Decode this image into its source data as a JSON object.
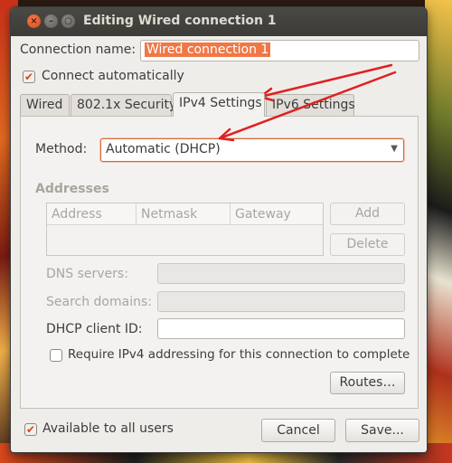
{
  "window": {
    "title": "Editing Wired connection 1"
  },
  "connection_name": {
    "label": "Connection name:",
    "value": "Wired connection 1"
  },
  "connect_automatically": {
    "label": "Connect automatically",
    "checked": true
  },
  "tabs": [
    {
      "label": "Wired",
      "active": false
    },
    {
      "label": "802.1x Security",
      "active": false
    },
    {
      "label": "IPv4 Settings",
      "active": true
    },
    {
      "label": "IPv6 Settings",
      "active": false
    }
  ],
  "ipv4": {
    "method_label": "Method:",
    "method_value": "Automatic (DHCP)",
    "addresses_heading": "Addresses",
    "columns": [
      "Address",
      "Netmask",
      "Gateway"
    ],
    "add_label": "Add",
    "delete_label": "Delete",
    "dns_label": "DNS servers:",
    "search_domains_label": "Search domains:",
    "dhcp_client_id_label": "DHCP client ID:",
    "require_label": "Require IPv4 addressing for this connection to complete",
    "require_checked": false,
    "routes_label": "Routes…"
  },
  "footer": {
    "available_label": "Available to all users",
    "available_checked": true,
    "cancel_label": "Cancel",
    "save_label": "Save..."
  },
  "colors": {
    "accent": "#f07746",
    "annotation": "#e02020",
    "titlebar": "#3c3b37"
  }
}
